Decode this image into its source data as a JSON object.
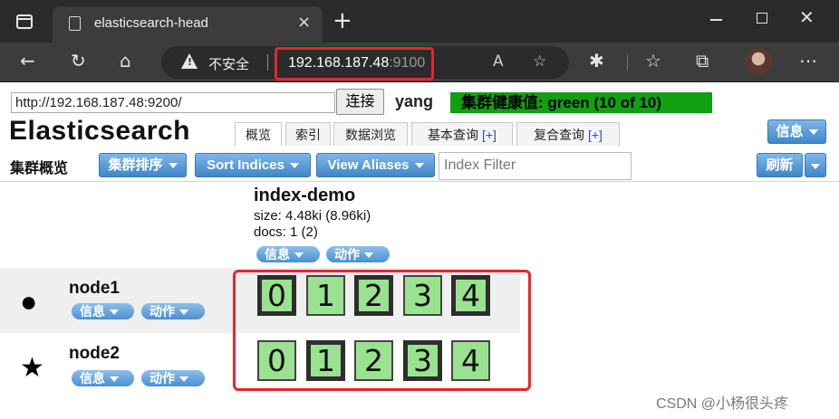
{
  "browser": {
    "tab_title": "elasticsearch-head",
    "new_tab": "+",
    "close_tab": "×",
    "insecure_label": "不安全",
    "url_host": "192.168.187.48",
    "url_port": ":9100",
    "highlight_color": "#e8262b"
  },
  "header": {
    "connect_url": "http://192.168.187.48:9200/",
    "connect_button": "连接",
    "cluster_name": "yang",
    "health": "集群健康值: green (10 of 10)",
    "health_color": "#10a010",
    "brand": "Elasticsearch",
    "tabs": [
      {
        "label": "概览"
      },
      {
        "label": "索引"
      },
      {
        "label": "数据浏览"
      },
      {
        "label": "基本查询",
        "plus": "[+]"
      },
      {
        "label": "复合查询",
        "plus": "[+]"
      }
    ],
    "info_button": "信息"
  },
  "overview": {
    "title": "集群概览",
    "sort_cluster": "集群排序",
    "sort_indices": "Sort Indices",
    "view_aliases": "View Aliases",
    "filter_placeholder": "Index Filter",
    "refresh": "刷新"
  },
  "index": {
    "name": "index-demo",
    "size": "size: 4.48ki (8.96ki)",
    "docs": "docs: 1 (2)",
    "info": "信息",
    "action": "动作"
  },
  "nodes": [
    {
      "name": "node1",
      "symbol": "●",
      "info": "信息",
      "action": "动作",
      "shards": [
        {
          "id": "0",
          "primary": true
        },
        {
          "id": "1",
          "primary": false
        },
        {
          "id": "2",
          "primary": true
        },
        {
          "id": "3",
          "primary": false
        },
        {
          "id": "4",
          "primary": true
        }
      ]
    },
    {
      "name": "node2",
      "symbol": "★",
      "info": "信息",
      "action": "动作",
      "shards": [
        {
          "id": "0",
          "primary": false
        },
        {
          "id": "1",
          "primary": true
        },
        {
          "id": "2",
          "primary": false
        },
        {
          "id": "3",
          "primary": true
        },
        {
          "id": "4",
          "primary": false
        }
      ]
    }
  ],
  "shard_color": "#99e28f",
  "watermark": "CSDN @小杨很头疼"
}
